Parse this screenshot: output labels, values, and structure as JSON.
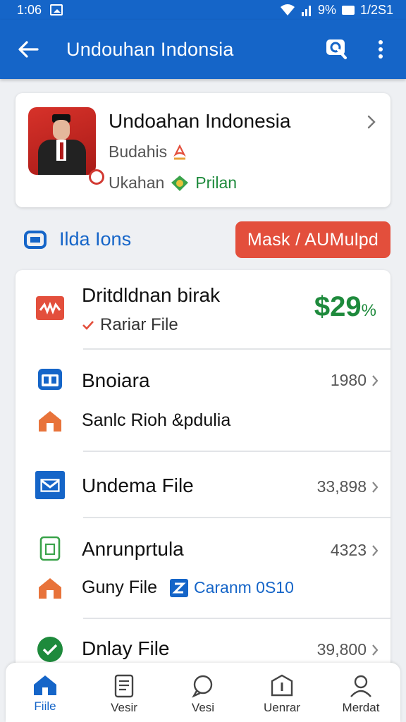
{
  "status_bar": {
    "time": "1:06",
    "battery_text": "9%",
    "right_time": "1/2S1"
  },
  "app_bar": {
    "title": "Undouhan Indonsia",
    "back_icon": "arrow-left-icon",
    "search_icon": "search-icon",
    "more_icon": "more-vert-icon"
  },
  "profile": {
    "name": "Undoahan Indonesia",
    "line1": "Budahis",
    "line2_prefix": "Ukahan",
    "line2_badge": "Prilan"
  },
  "section": {
    "label": "Ilda Ions",
    "action_label": "Mask / AUMulpd"
  },
  "list": [
    {
      "title": "Dritdldnan birak",
      "sub": "Rariar File",
      "value": "$29",
      "value_suffix": "%"
    },
    {
      "title": "Bnoiara",
      "sub": "Sanlc Rioh &pdulia",
      "value": "1980"
    },
    {
      "title": "Undema File",
      "value": "33,898"
    },
    {
      "title": "Anrunprtula",
      "sub": "Guny File",
      "link": "Caranm 0S10",
      "value": "4323"
    },
    {
      "title": "Dnlay File",
      "value": "39,800"
    }
  ],
  "bottom_nav": [
    {
      "label": "Fiile",
      "icon": "home-icon",
      "active": true
    },
    {
      "label": "Vesir",
      "icon": "document-icon",
      "active": false
    },
    {
      "label": "Vesi",
      "icon": "chat-icon",
      "active": false
    },
    {
      "label": "Uenrar",
      "icon": "info-icon",
      "active": false
    },
    {
      "label": "Merdat",
      "icon": "person-icon",
      "active": false
    }
  ],
  "colors": {
    "primary": "#1565c8",
    "accent": "#e34f3c",
    "positive": "#1e8a3c"
  }
}
